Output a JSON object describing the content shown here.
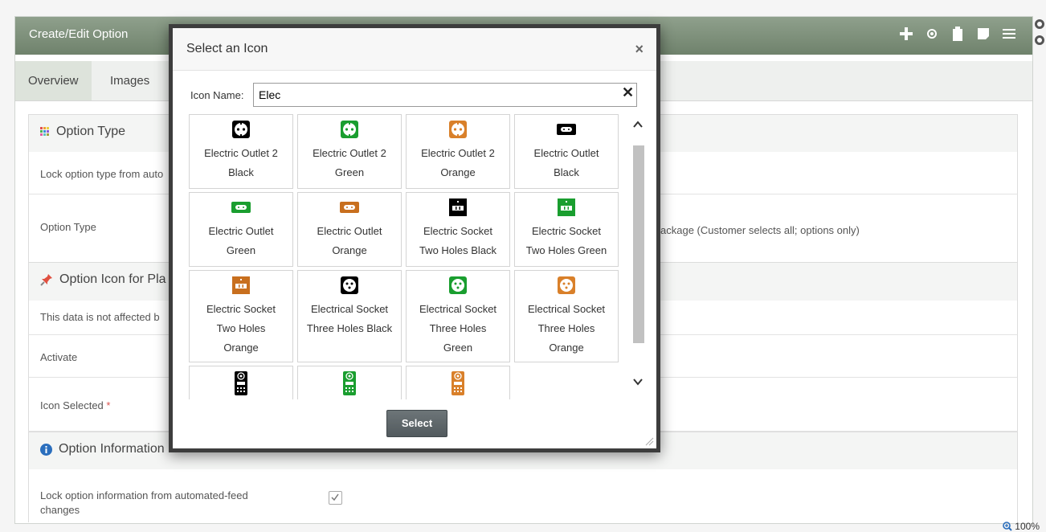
{
  "panel": {
    "title": "Create/Edit Option",
    "header_icons": [
      "plus-icon",
      "eye-icon",
      "clipboard-icon",
      "note-icon",
      "list-icon"
    ]
  },
  "tabs": [
    {
      "label": "Overview"
    },
    {
      "label": "Images"
    }
  ],
  "sections": {
    "option_type": {
      "title": "Option Type",
      "lock_label": "Lock option type from auto",
      "option_type_label": "Option Type",
      "option_type_value_tail": "ackage (Customer selects all; options only)"
    },
    "option_icon": {
      "title": "Option Icon for Pla",
      "note": "This data is not affected b",
      "activate_label": "Activate",
      "icon_selected_label": "Icon Selected",
      "required_mark": "*"
    },
    "option_information": {
      "title": "Option Information",
      "lock_label_line1": "Lock option information from automated-feed",
      "lock_label_line2": "changes"
    }
  },
  "zoom": "100%",
  "modal": {
    "title": "Select an Icon",
    "close": "×",
    "icon_name_label": "Icon Name:",
    "icon_name_value": "Elec",
    "clear": "✕",
    "select_button": "Select",
    "icons": [
      {
        "line1": "Electric Outlet 2",
        "line2": "Black",
        "line3": "",
        "shape": "round",
        "color": "#000000"
      },
      {
        "line1": "Electric Outlet 2",
        "line2": "Green",
        "line3": "",
        "shape": "round",
        "color": "#1a9e2f"
      },
      {
        "line1": "Electric Outlet 2",
        "line2": "Orange",
        "line3": "",
        "shape": "round",
        "color": "#d9802a"
      },
      {
        "line1": "Electric Outlet",
        "line2": "Black",
        "line3": "",
        "shape": "slot",
        "color": "#000000"
      },
      {
        "line1": "Electric Outlet",
        "line2": "Green",
        "line3": "",
        "shape": "slot",
        "color": "#1a9e2f"
      },
      {
        "line1": "Electric Outlet",
        "line2": "Orange",
        "line3": "",
        "shape": "slot",
        "color": "#c86f1e"
      },
      {
        "line1": "Electric Socket",
        "line2": "Two Holes Black",
        "line3": "",
        "shape": "two",
        "color": "#000000"
      },
      {
        "line1": "Electric Socket",
        "line2": "Two Holes Green",
        "line3": "",
        "shape": "two",
        "color": "#1a9e2f"
      },
      {
        "line1": "Electric Socket",
        "line2": "Two Holes",
        "line3": "Orange",
        "shape": "two",
        "color": "#c86f1e"
      },
      {
        "line1": "Electrical Socket",
        "line2": "Three Holes Black",
        "line3": "",
        "shape": "three",
        "color": "#000000"
      },
      {
        "line1": "Electrical Socket",
        "line2": "Three Holes",
        "line3": "Green",
        "shape": "three",
        "color": "#1a9e2f"
      },
      {
        "line1": "Electrical Socket",
        "line2": "Three Holes",
        "line3": "Orange",
        "shape": "three",
        "color": "#d9802a"
      },
      {
        "line1": "",
        "line2": "",
        "line3": "",
        "shape": "panel",
        "color": "#000000"
      },
      {
        "line1": "",
        "line2": "",
        "line3": "",
        "shape": "panel",
        "color": "#1a9e2f"
      },
      {
        "line1": "",
        "line2": "",
        "line3": "",
        "shape": "panel",
        "color": "#d9802a"
      }
    ]
  }
}
